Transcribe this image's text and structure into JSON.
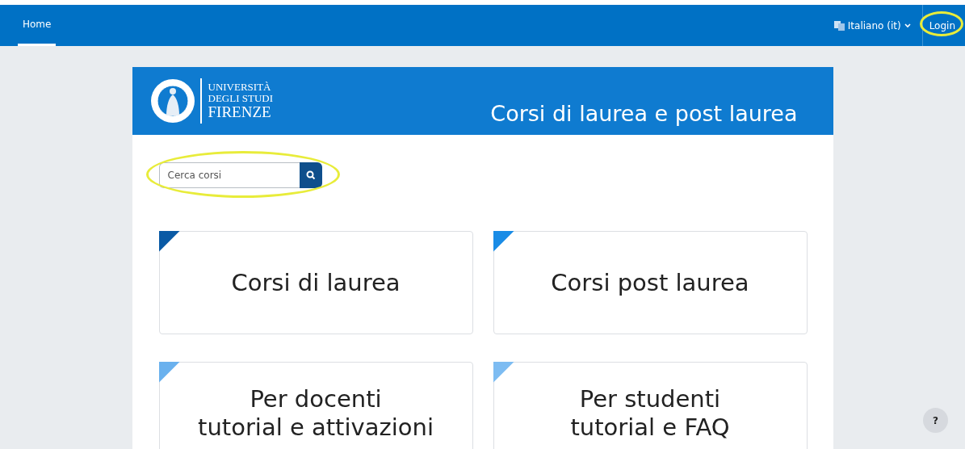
{
  "navbar": {
    "tabs": [
      {
        "label": "Home",
        "selected": true
      }
    ],
    "language": {
      "label": "Italiano (it)"
    },
    "login": {
      "label": "Login",
      "highlighted": true
    }
  },
  "header": {
    "logo_lines": [
      "UNIVERSITÀ",
      "DEGLI STUDI",
      "FIRENZE"
    ],
    "title": "Corsi di laurea e post laurea"
  },
  "search": {
    "placeholder": "Cerca corsi",
    "highlighted": true
  },
  "tiles": [
    {
      "lines": [
        "Corsi di laurea"
      ],
      "color": "#0a5aa5"
    },
    {
      "lines": [
        "Corsi post laurea"
      ],
      "color": "#1a8ce6"
    },
    {
      "lines": [
        "Per docenti",
        "tutorial e attivazioni"
      ],
      "color": "#6ab1ee"
    },
    {
      "lines": [
        "Per studenti",
        "tutorial e FAQ"
      ],
      "color": "#7dbcf2"
    }
  ],
  "help_button": {
    "label": "?"
  }
}
